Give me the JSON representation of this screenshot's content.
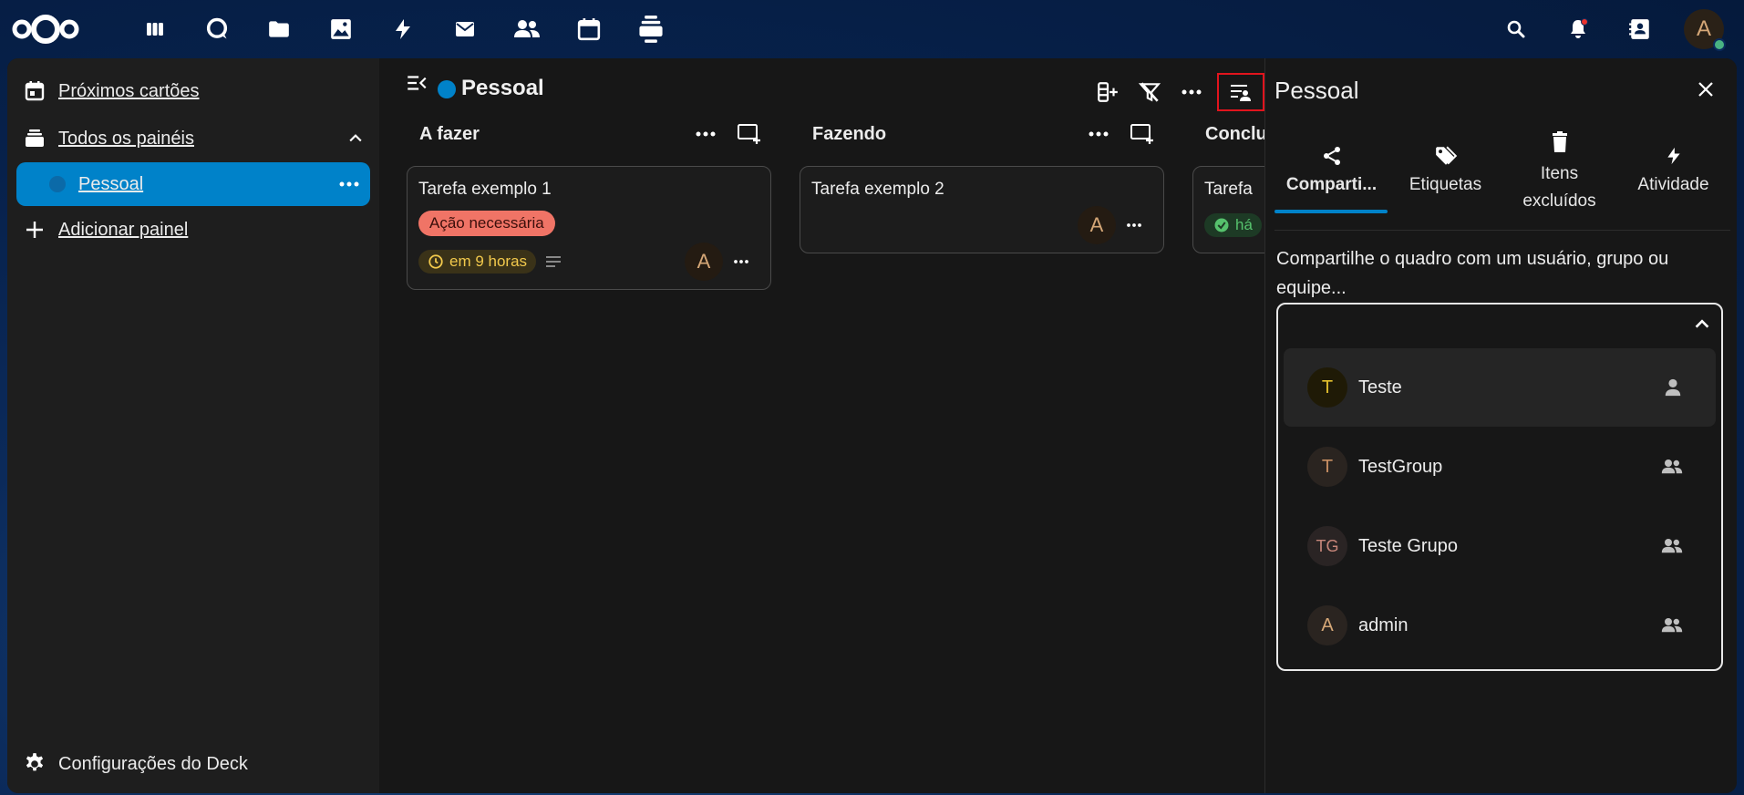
{
  "topbar": {
    "apps": [
      "dashboard-icon",
      "talk-icon",
      "files-icon",
      "photos-icon",
      "activity-icon",
      "mail-icon",
      "contacts-icon",
      "calendar-icon",
      "deck-icon"
    ],
    "user_initial": "A"
  },
  "nav": {
    "upcoming": "Próximos cartões",
    "all_boards": "Todos os painéis",
    "boards": [
      {
        "label": "Pessoal",
        "color": "#0b6aa8"
      }
    ],
    "add_board": "Adicionar painel",
    "settings": "Configurações do Deck"
  },
  "board": {
    "title": "Pessoal",
    "color": "#0082c9",
    "stacks": [
      {
        "title": "A fazer",
        "cards": [
          {
            "title": "Tarefa exemplo 1",
            "label": "Ação necessária",
            "due": "em 9 horas",
            "assignee": "A"
          }
        ]
      },
      {
        "title": "Fazendo",
        "cards": [
          {
            "title": "Tarefa exemplo 2",
            "assignee": "A"
          }
        ]
      },
      {
        "title": "Conclu",
        "cards": [
          {
            "title": "Tarefa",
            "done": "há"
          }
        ]
      }
    ]
  },
  "sidebar": {
    "title": "Pessoal",
    "tabs": [
      {
        "label": "Comparti...",
        "icon": "share-icon"
      },
      {
        "label": "Etiquetas",
        "icon": "tag-icon"
      },
      {
        "label": "Itens excluídos",
        "icon": "trash-icon"
      },
      {
        "label": "Atividade",
        "icon": "activity-icon"
      }
    ],
    "hint": "Compartilhe o quadro com um usuário, grupo ou equipe...",
    "share_options": [
      {
        "initials": "T",
        "name": "Teste",
        "type": "user",
        "avatar_bg": "#1f1a06",
        "avatar_fg": "#e4c12e"
      },
      {
        "initials": "T",
        "name": "TestGroup",
        "type": "group",
        "avatar_bg": "#2a2420",
        "avatar_fg": "#c98f63"
      },
      {
        "initials": "TG",
        "name": "Teste Grupo",
        "type": "group",
        "avatar_bg": "#2a2424",
        "avatar_fg": "#c7867a"
      },
      {
        "initials": "A",
        "name": "admin",
        "type": "group",
        "avatar_bg": "#2a2420",
        "avatar_fg": "#d5a777"
      }
    ]
  },
  "colors": {
    "accent": "#0082c9",
    "highlight": "#e1141d",
    "label": "#f07466"
  }
}
